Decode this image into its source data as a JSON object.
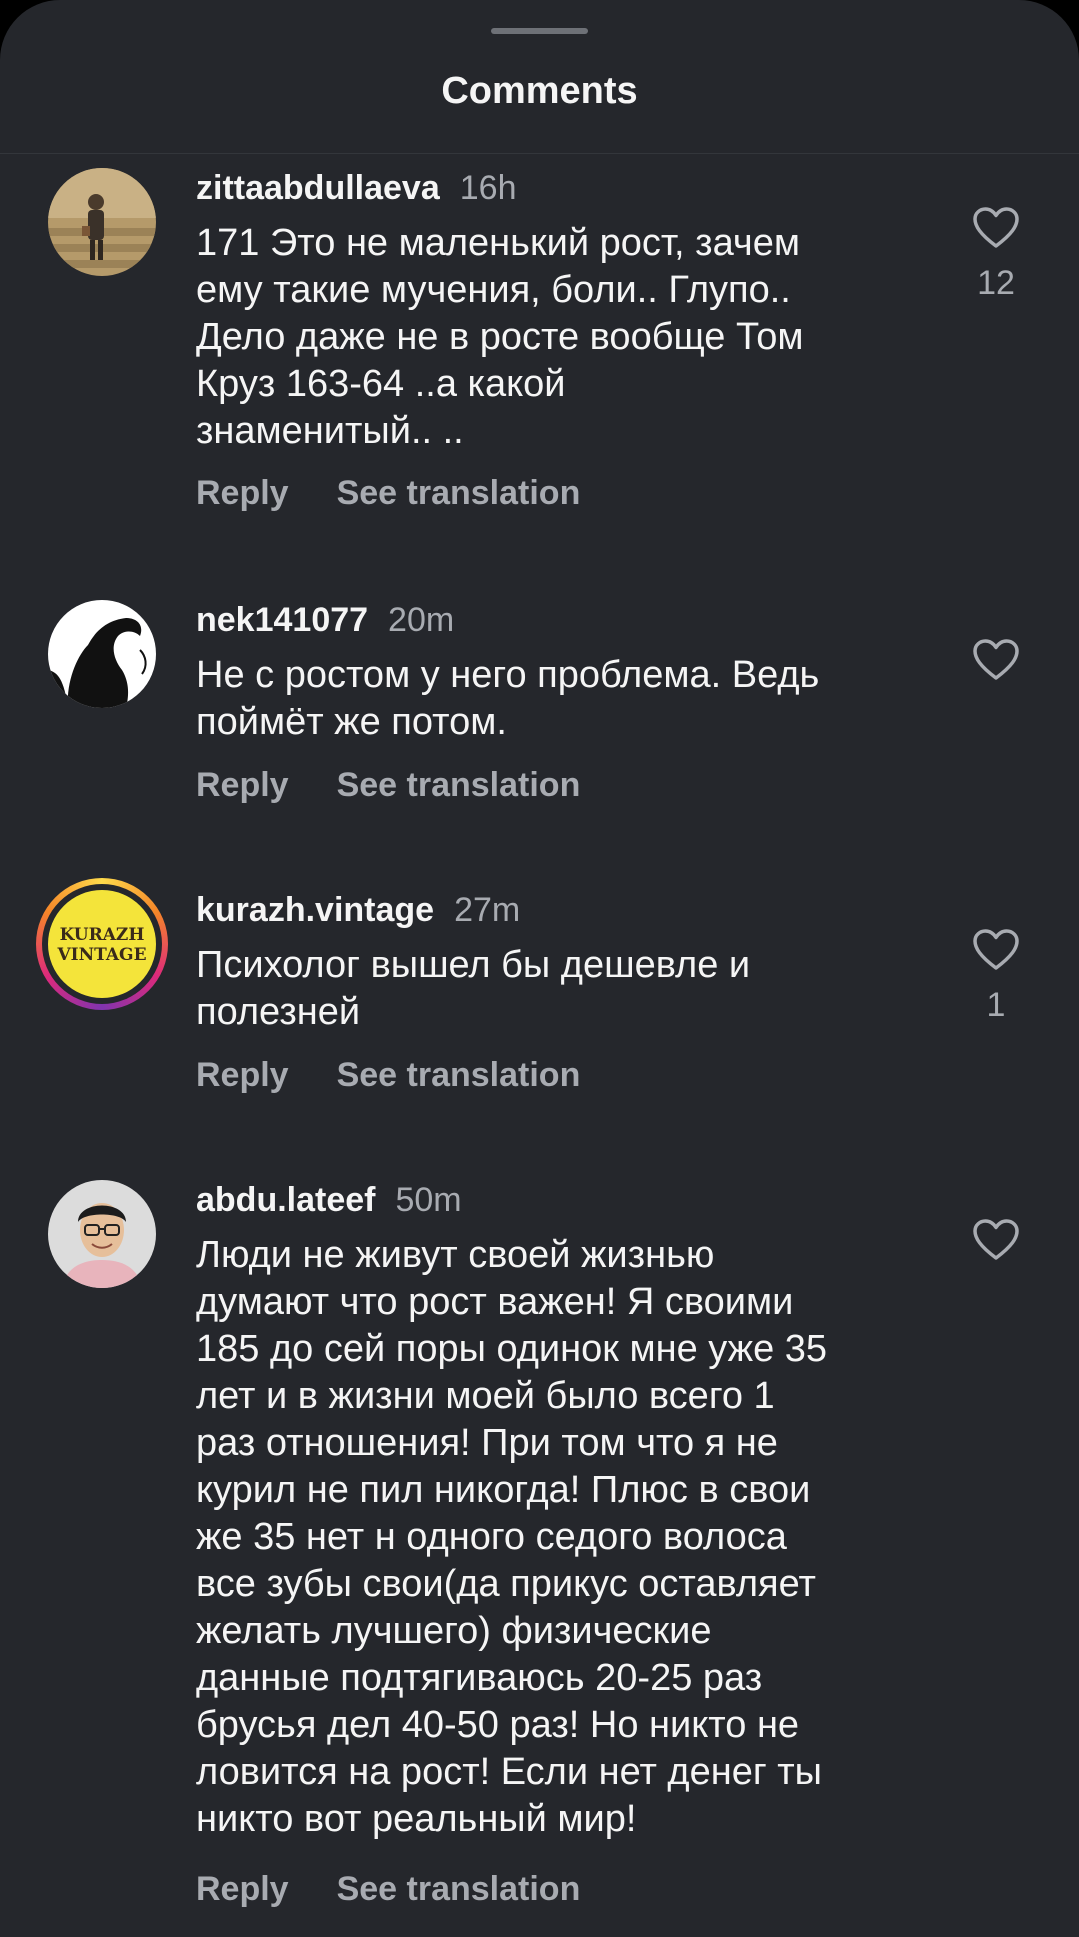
{
  "header": {
    "title": "Comments"
  },
  "comments": [
    {
      "username": "zittaabdullaeva",
      "time": "16h",
      "text": "171 Это не маленький рост, зачем\nему такие мучения, боли.. Глупо..\nДело даже  не в росте вообще Том\nКруз  163-64 ..а какой\nзнаменитый.. ..",
      "reply_label": "Reply",
      "translate_label": "See translation",
      "likes": "12"
    },
    {
      "username": "nek141077",
      "time": "20m",
      "text": "Не с ростом у него проблема. Ведь\nпоймёт же потом.",
      "reply_label": "Reply",
      "translate_label": "See translation",
      "likes": ""
    },
    {
      "username": "kurazh.vintage",
      "time": "27m",
      "text": "Психолог вышел бы дешевле и\nполезней",
      "reply_label": "Reply",
      "translate_label": "See translation",
      "likes": "1",
      "avatar_logo": "KURAZH VINTAGE"
    },
    {
      "username": "abdu.lateef",
      "time": "50m",
      "text": "Люди не живут своей жизнью\nдумают что рост важен! Я своими\n185 до сей поры одинок мне уже 35\nлет и в жизни моей было всего 1\nраз отношения! При том что я не\nкурил не пил никогда! Плюс в свои\nже 35 нет н  одного седого волоса\nвсе зубы свои(да прикус оставляет\nжелать лучшего) физические\nданные подтягиваюсь 20-25 раз\nбрусья дел 40-50 раз! Но никто не\nловится на рост! Если нет денег ты\nникто вот реальный мир!",
      "reply_label": "Reply",
      "translate_label": "See translation",
      "likes": ""
    }
  ],
  "icons": {
    "like": "heart-outline-icon"
  },
  "colors": {
    "background": "#25272c",
    "primary_text": "#f5f5f5",
    "secondary_text": "#a8abb1",
    "logo_yellow": "#f4e43a"
  }
}
